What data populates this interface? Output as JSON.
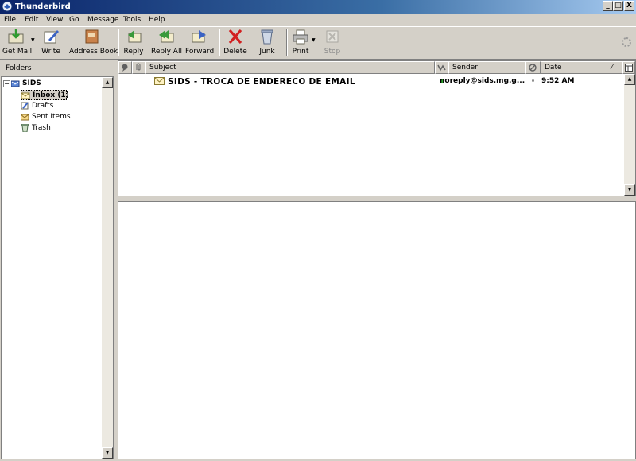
{
  "window": {
    "title": "Thunderbird",
    "controls": {
      "minimize": "_",
      "maximize": "□",
      "close": "X"
    }
  },
  "menu": [
    "File",
    "Edit",
    "View",
    "Go",
    "Message",
    "Tools",
    "Help"
  ],
  "toolbar": {
    "get_mail": "Get Mail",
    "write": "Write",
    "address_book": "Address Book",
    "reply": "Reply",
    "reply_all": "Reply All",
    "forward": "Forward",
    "delete": "Delete",
    "junk": "Junk",
    "print": "Print",
    "stop": "Stop"
  },
  "folders": {
    "header": "Folders",
    "account": "SIDS",
    "items": [
      {
        "label": "Inbox (1)",
        "icon": "inbox-icon",
        "selected": true
      },
      {
        "label": "Drafts",
        "icon": "drafts-icon"
      },
      {
        "label": "Sent Items",
        "icon": "sent-icon"
      },
      {
        "label": "Trash",
        "icon": "trash-icon"
      }
    ]
  },
  "thread": {
    "columns": {
      "subject": "Subject",
      "sender": "Sender",
      "date": "Date"
    },
    "messages": [
      {
        "subject": "SIDS - TROCA DE ENDERECO DE EMAIL",
        "sender": "noreply@sids.mg.g...",
        "date": "9:52 AM",
        "unread": true
      }
    ]
  },
  "colors": {
    "title_gradient_start": "#0a246a",
    "title_gradient_end": "#a6caf0",
    "chrome": "#d4d0c8",
    "unread_dot": "#2fa52f"
  }
}
